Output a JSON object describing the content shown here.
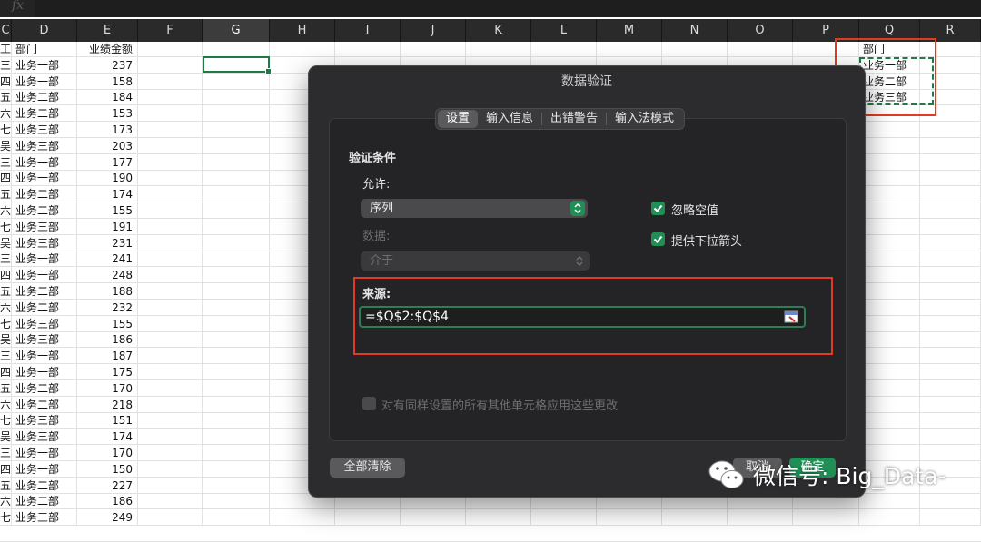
{
  "formula_bar": {
    "fx_label": "fx",
    "value": ""
  },
  "columns": [
    {
      "label": "C",
      "w": 13
    },
    {
      "label": "D",
      "w": 72
    },
    {
      "label": "E",
      "w": 67
    },
    {
      "label": "F",
      "w": 71
    },
    {
      "label": "G",
      "w": 74,
      "selected": true
    },
    {
      "label": "H",
      "w": 72
    },
    {
      "label": "I",
      "w": 72
    },
    {
      "label": "J",
      "w": 72
    },
    {
      "label": "K",
      "w": 72
    },
    {
      "label": "L",
      "w": 72
    },
    {
      "label": "M",
      "w": 72
    },
    {
      "label": "N",
      "w": 72
    },
    {
      "label": "O",
      "w": 72
    },
    {
      "label": "P",
      "w": 73
    },
    {
      "label": "Q",
      "w": 67
    },
    {
      "label": "R",
      "w": 67
    }
  ],
  "sheet": {
    "header": {
      "c": "工",
      "d": "部门",
      "e": "业绩金额"
    },
    "rows": [
      {
        "c": "三",
        "d": "业务一部",
        "e": "237"
      },
      {
        "c": "四",
        "d": "业务一部",
        "e": "158"
      },
      {
        "c": "五",
        "d": "业务二部",
        "e": "184"
      },
      {
        "c": "六",
        "d": "业务二部",
        "e": "153"
      },
      {
        "c": "七",
        "d": "业务三部",
        "e": "173"
      },
      {
        "c": "吴",
        "d": "业务三部",
        "e": "203"
      },
      {
        "c": "三",
        "d": "业务一部",
        "e": "177"
      },
      {
        "c": "四",
        "d": "业务一部",
        "e": "190"
      },
      {
        "c": "五",
        "d": "业务二部",
        "e": "174"
      },
      {
        "c": "六",
        "d": "业务二部",
        "e": "155"
      },
      {
        "c": "七",
        "d": "业务三部",
        "e": "191"
      },
      {
        "c": "吴",
        "d": "业务三部",
        "e": "231"
      },
      {
        "c": "三",
        "d": "业务一部",
        "e": "241"
      },
      {
        "c": "四",
        "d": "业务一部",
        "e": "248"
      },
      {
        "c": "五",
        "d": "业务二部",
        "e": "188"
      },
      {
        "c": "六",
        "d": "业务二部",
        "e": "232"
      },
      {
        "c": "七",
        "d": "业务三部",
        "e": "155"
      },
      {
        "c": "吴",
        "d": "业务三部",
        "e": "186"
      },
      {
        "c": "三",
        "d": "业务一部",
        "e": "187"
      },
      {
        "c": "四",
        "d": "业务一部",
        "e": "175"
      },
      {
        "c": "五",
        "d": "业务二部",
        "e": "170"
      },
      {
        "c": "六",
        "d": "业务二部",
        "e": "218"
      },
      {
        "c": "七",
        "d": "业务三部",
        "e": "151"
      },
      {
        "c": "吴",
        "d": "业务三部",
        "e": "174"
      },
      {
        "c": "三",
        "d": "业务一部",
        "e": "170"
      },
      {
        "c": "四",
        "d": "业务一部",
        "e": "150"
      },
      {
        "c": "五",
        "d": "业务二部",
        "e": "227"
      },
      {
        "c": "六",
        "d": "业务二部",
        "e": "186"
      },
      {
        "c": "七",
        "d": "业务三部",
        "e": "249"
      }
    ],
    "q_column": [
      "部门",
      "业务一部",
      "业务二部",
      "业务三部"
    ]
  },
  "dialog": {
    "title": "数据验证",
    "tabs": [
      "设置",
      "输入信息",
      "出错警告",
      "输入法模式"
    ],
    "active_tab": 0,
    "section_title": "验证条件",
    "allow_label": "允许:",
    "allow_value": "序列",
    "data_label": "数据:",
    "data_value": "介于",
    "ignore_blank_label": "忽略空值",
    "ignore_blank_checked": true,
    "dropdown_label": "提供下拉箭头",
    "dropdown_checked": true,
    "source_label": "来源:",
    "source_value": "=$Q$2:$Q$4",
    "apply_all_label": "对有同样设置的所有其他单元格应用这些更改",
    "apply_all_checked": false,
    "clear_all_button": "全部清除",
    "cancel_button": "取消",
    "ok_button": "确定"
  },
  "watermark": {
    "text": "微信号: Big_Data-"
  },
  "colors": {
    "accent": "#1f8f55",
    "annotation": "#e13b22",
    "selection": "#1f7a45"
  }
}
